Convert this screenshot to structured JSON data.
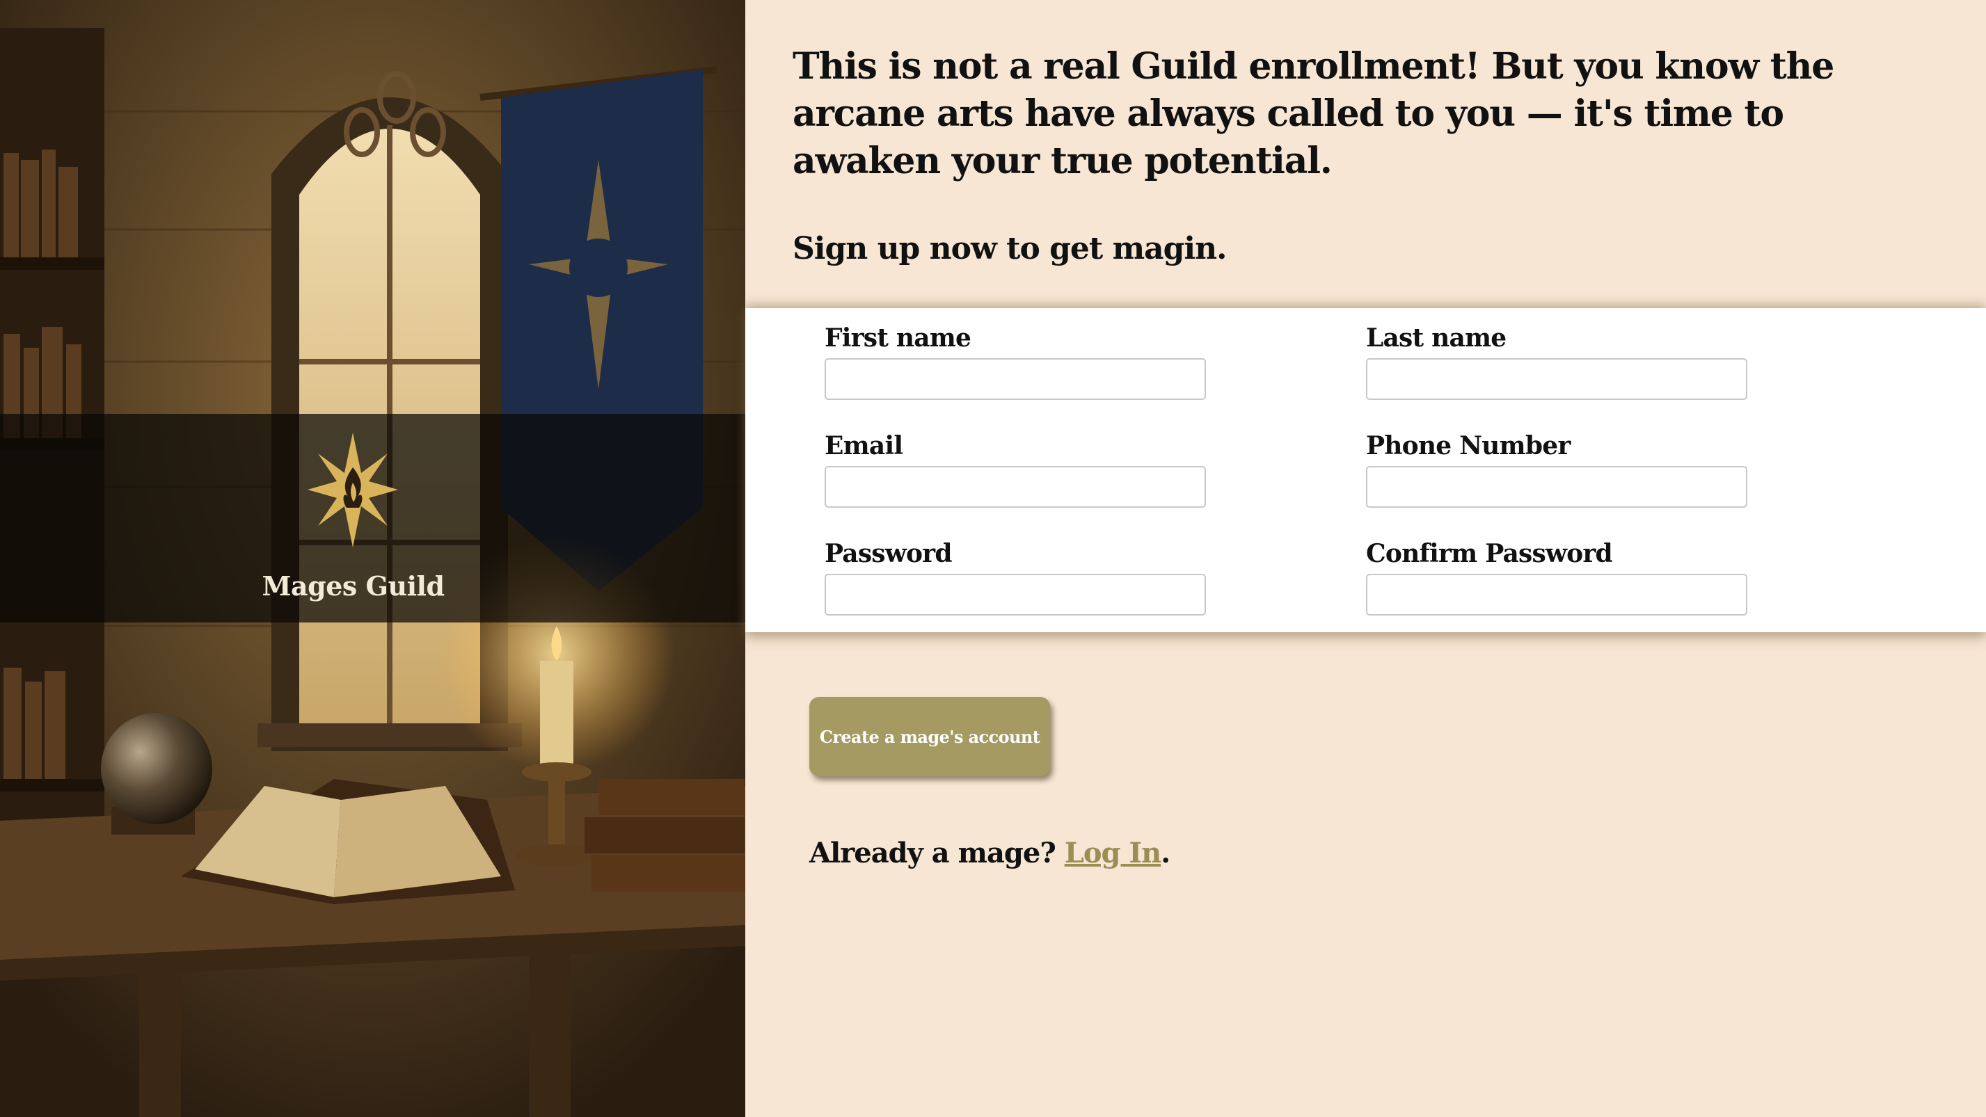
{
  "brand": {
    "name": "Mages Guild",
    "emblem_icon": "flame-star-icon"
  },
  "intro": {
    "headline": "This is not a real Guild enrollment! But you know the arcane arts have always called to you — it's time to awaken your true potential.",
    "subheadline": "Sign up now to get magin."
  },
  "form": {
    "first_name": {
      "label": "First name",
      "value": "",
      "placeholder": ""
    },
    "last_name": {
      "label": "Last name",
      "value": "",
      "placeholder": ""
    },
    "email": {
      "label": "Email",
      "value": "",
      "placeholder": ""
    },
    "phone": {
      "label": "Phone Number",
      "value": "",
      "placeholder": ""
    },
    "password": {
      "label": "Password",
      "value": "",
      "placeholder": ""
    },
    "confirm_password": {
      "label": "Confirm Password",
      "value": "",
      "placeholder": ""
    }
  },
  "actions": {
    "create_label": "Create a mage's account"
  },
  "login": {
    "prompt": "Already a mage?",
    "link_label": "Log In",
    "suffix": "."
  },
  "colors": {
    "page_background": "#f7e6d4",
    "card_background": "#ffffff",
    "button_background": "#a49a62",
    "link": "#9a8e55",
    "emblem_gold": "#d9b45a",
    "banner_blue": "#1d2c49"
  }
}
